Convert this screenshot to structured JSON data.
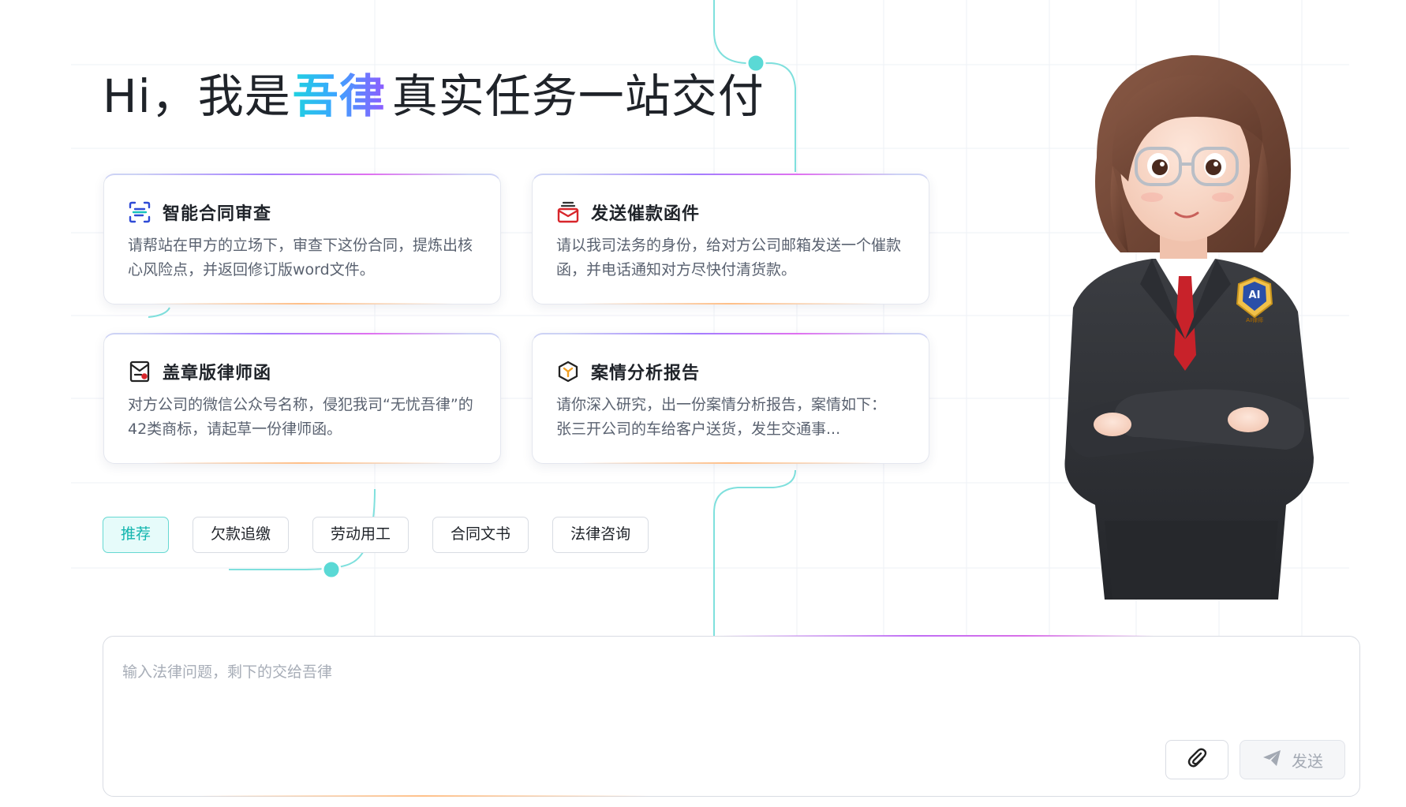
{
  "headline": {
    "prefix": "Hi，我是",
    "brand": "吾律",
    "suffix": "真实任务一站交付"
  },
  "cards": [
    {
      "icon": "scan-document-icon",
      "title": "智能合同审查",
      "description": "请帮站在甲方的立场下，审查下这份合同，提炼出核心风险点，并返回修订版word文件。"
    },
    {
      "icon": "mail-envelope-icon",
      "title": "发送催款函件",
      "description": "请以我司法务的身份，给对方公司邮箱发送一个催款函，并电话通知对方尽快付清货款。"
    },
    {
      "icon": "stamped-letter-icon",
      "title": "盖章版律师函",
      "description": "对方公司的微信公众号名称，侵犯我司“无忧吾律”的42类商标，请起草一份律师函。"
    },
    {
      "icon": "hexagon-cube-icon",
      "title": "案情分析报告",
      "description": "请你深入研究，出一份案情分析报告，案情如下： 张三开公司的车给客户送货，发生交通事..."
    }
  ],
  "tags": [
    {
      "label": "推荐",
      "active": true
    },
    {
      "label": "欠款追缴",
      "active": false
    },
    {
      "label": "劳动用工",
      "active": false
    },
    {
      "label": "合同文书",
      "active": false
    },
    {
      "label": "法律咨询",
      "active": false
    }
  ],
  "avatar": {
    "badge_text": "AI",
    "badge_subtext": "AI律师"
  },
  "composer": {
    "placeholder": "输入法律问题，剩下的交给吾律",
    "value": "",
    "attach_icon": "paperclip-icon",
    "send_icon": "paper-plane-icon",
    "send_label": "发送"
  },
  "colors": {
    "accent_teal": "#12b5ae",
    "brand_gradient_start": "#1fd2e0",
    "brand_gradient_end": "#8f5bff"
  }
}
